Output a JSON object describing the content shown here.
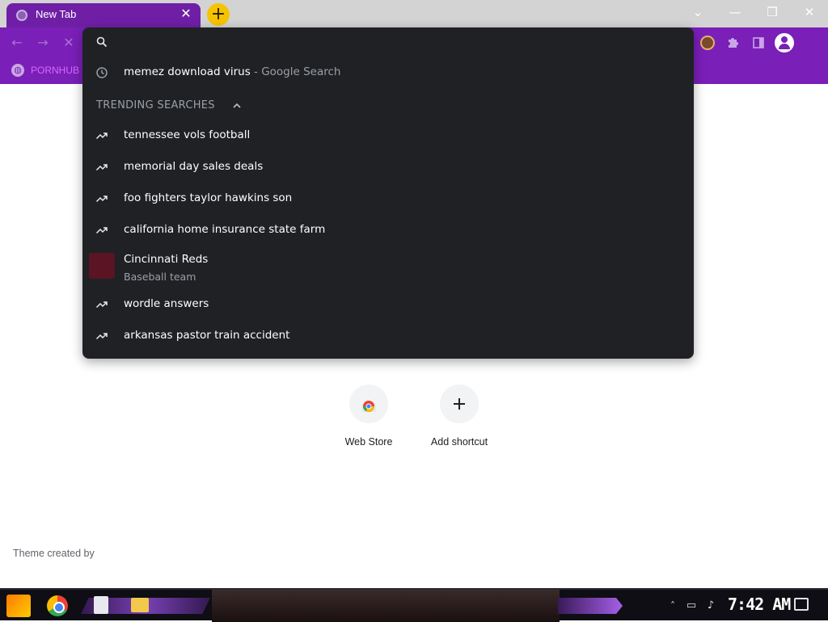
{
  "window": {
    "tab_title": "New Tab",
    "tab_close": "✕",
    "new_tab_symbol": "+",
    "controls": {
      "list": "⌄",
      "minimize": "—",
      "restore": "❐",
      "close": "✕"
    }
  },
  "toolbar": {
    "back": "←",
    "forward": "→",
    "stop": "✕"
  },
  "bookmarks": {
    "items": [
      {
        "label": "PORNHUB"
      }
    ]
  },
  "omnibox": {
    "input_value": "",
    "history": {
      "query": "memez download virus",
      "suffix": " - Google Search"
    },
    "trending_header": "TRENDING SEARCHES",
    "trending": [
      "tennessee vols football",
      "memorial day sales deals",
      "foo fighters taylor hawkins son",
      "california home insurance state farm"
    ],
    "entity": {
      "title": "Cincinnati Reds",
      "subtitle": "Baseball team",
      "thumb_color": "#5a1424"
    },
    "trending_more": [
      "wordle answers",
      "arkansas pastor train accident"
    ]
  },
  "page": {
    "shortcuts": [
      {
        "label": "Web Store",
        "icon": "chrome-web-store-icon"
      },
      {
        "label": "Add shortcut",
        "icon": "plus-icon"
      }
    ],
    "theme_credit": "Theme created by"
  },
  "taskbar": {
    "clock": "7:42 AM"
  },
  "colors": {
    "theme_purple": "#7a1fb8",
    "tab_purple": "#6f1fa6",
    "dropdown_bg": "#202124",
    "new_tab_yellow": "#f5c400"
  }
}
